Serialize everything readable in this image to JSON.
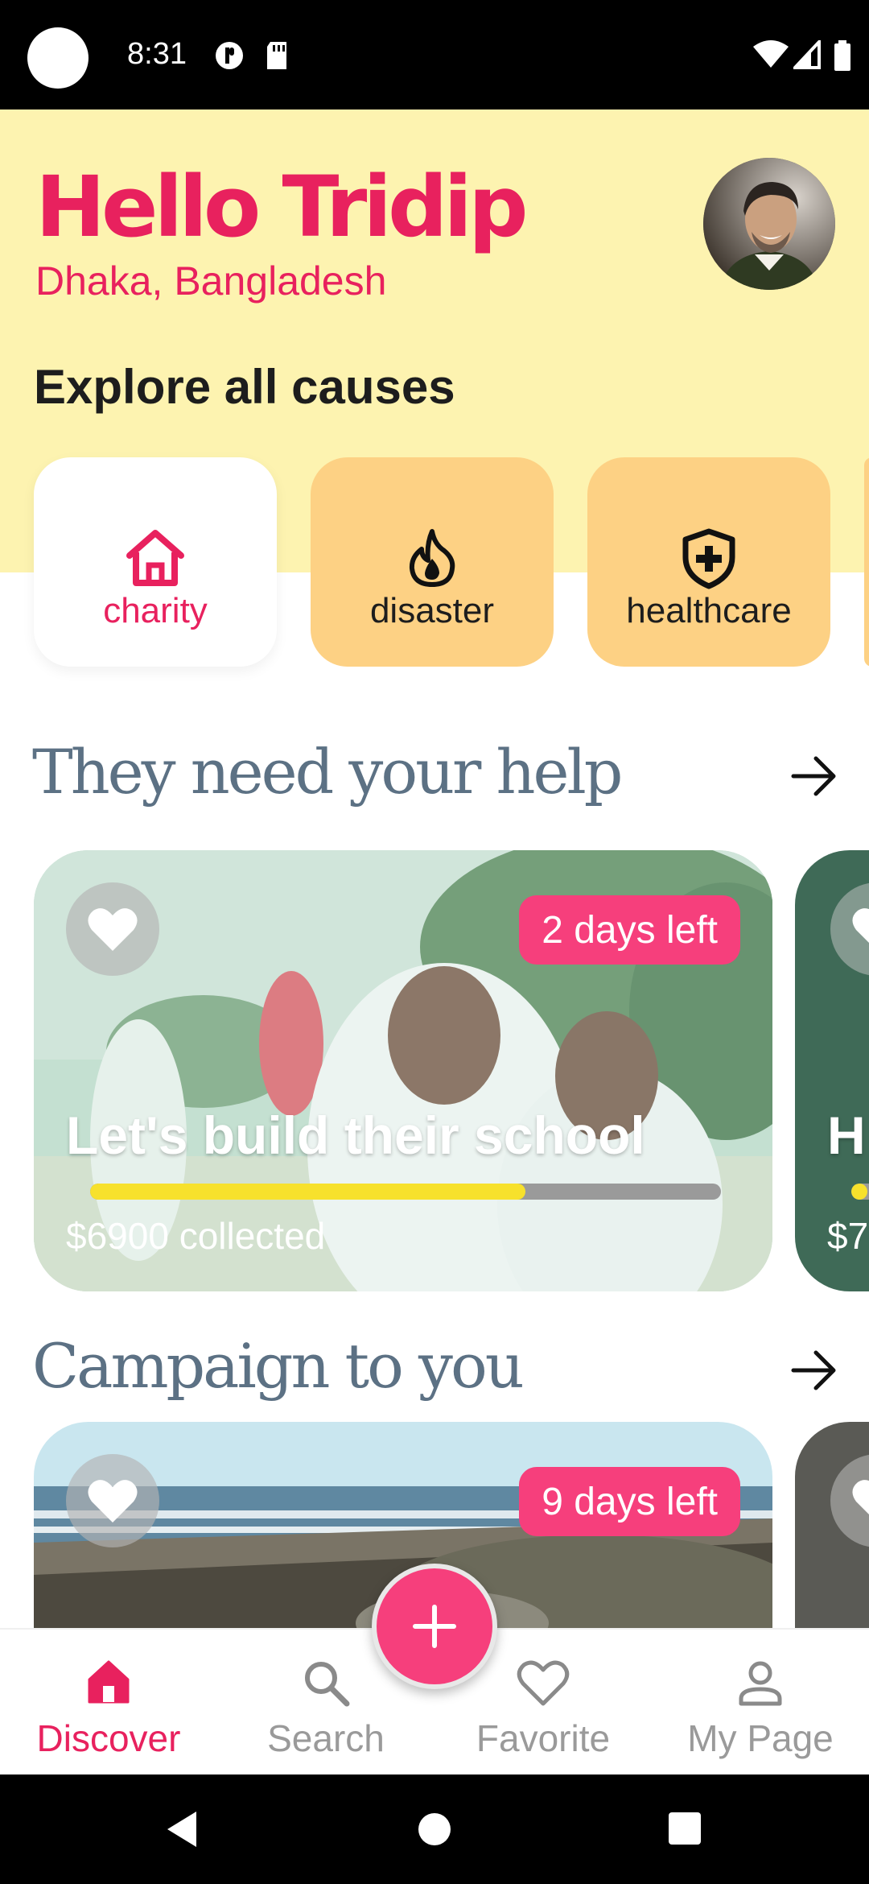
{
  "status_bar": {
    "time": "8:31"
  },
  "header": {
    "greeting": "Hello Tridip",
    "location": "Dhaka, Bangladesh",
    "avatar_icon": "user-avatar"
  },
  "explore": {
    "title": "Explore all causes",
    "categories": [
      {
        "label": "charity",
        "icon": "home-icon",
        "active": true
      },
      {
        "label": "disaster",
        "icon": "flame-icon",
        "active": false
      },
      {
        "label": "healthcare",
        "icon": "shield-plus-icon",
        "active": false
      }
    ]
  },
  "need_help": {
    "title": "They need your help",
    "cards": [
      {
        "days_left": "2 days left",
        "title": "Let's build their school",
        "collected": "$6900 collected",
        "progress": 0.69
      },
      {
        "title": "H",
        "collected": "$7",
        "progress": 0.1
      }
    ]
  },
  "campaign": {
    "title": "Campaign to you",
    "cards": [
      {
        "days_left": "9 days left"
      }
    ]
  },
  "bottom_nav": {
    "items": [
      {
        "label": "Discover",
        "icon": "home-icon",
        "active": true
      },
      {
        "label": "Search",
        "icon": "search-icon",
        "active": false
      },
      {
        "label": "Favorite",
        "icon": "heart-icon",
        "active": false
      },
      {
        "label": "My Page",
        "icon": "person-icon",
        "active": false
      }
    ],
    "fab_icon": "plus-icon"
  },
  "colors": {
    "primary": "#e8215e",
    "badge": "#f63f7c",
    "header_bg": "#fdf3b0",
    "category_bg": "#fdd184",
    "section_title": "#5c7184",
    "progress": "#f7e12c"
  }
}
